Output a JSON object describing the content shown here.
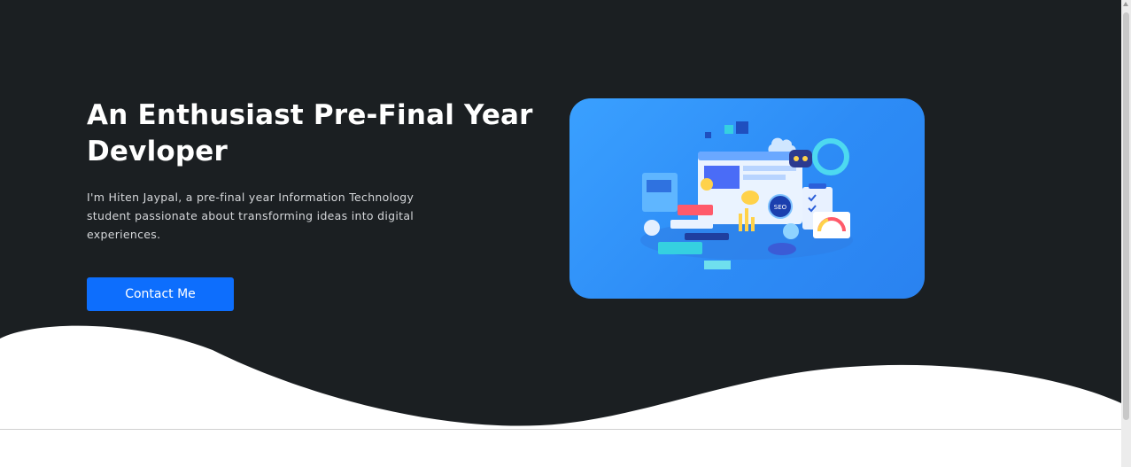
{
  "hero": {
    "headline": "An Enthusiast Pre-Final Year Devloper",
    "subtitle": "I'm Hiten Jaypal, a pre-final year Information Technology student passionate about transforming ideas into digital experiences.",
    "contact_button_label": "Contact Me",
    "illustration_icon": "web-development-isometric-illustration",
    "badge_text": "SEO"
  },
  "colors": {
    "hero_background": "#1b1f22",
    "primary_button": "#0d6efd",
    "illustration_background": "#3aa0ff",
    "text_light": "#ffffff"
  }
}
